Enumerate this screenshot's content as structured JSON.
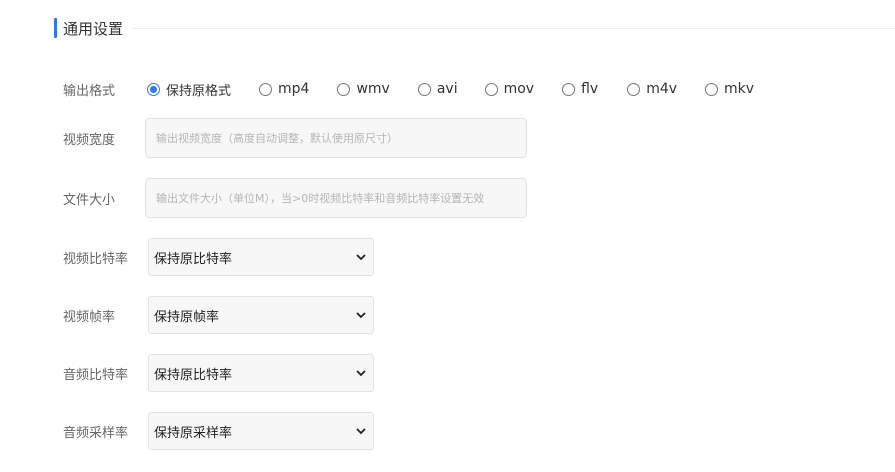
{
  "section": {
    "title": "通用设置",
    "accent_color": "#2b7cf0"
  },
  "format": {
    "label": "输出格式",
    "options": [
      "保持原格式",
      "mp4",
      "wmv",
      "avi",
      "mov",
      "flv",
      "m4v",
      "mkv"
    ],
    "selected": "保持原格式"
  },
  "video_width": {
    "label": "视频宽度",
    "placeholder": "输出视频宽度（高度自动调整，默认使用原尺寸）",
    "value": ""
  },
  "file_size": {
    "label": "文件大小",
    "placeholder": "输出文件大小（单位M），当>0时视频比特率和音频比特率设置无效",
    "value": ""
  },
  "video_bitrate": {
    "label": "视频比特率",
    "selected": "保持原比特率"
  },
  "video_framerate": {
    "label": "视频帧率",
    "selected": "保持原帧率"
  },
  "audio_bitrate": {
    "label": "音频比特率",
    "selected": "保持原比特率"
  },
  "audio_samplerate": {
    "label": "音频采样率",
    "selected": "保持原采样率"
  }
}
